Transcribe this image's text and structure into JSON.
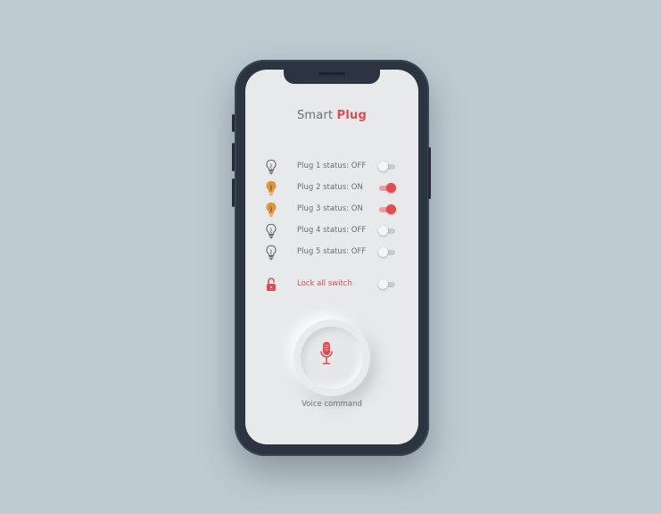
{
  "app": {
    "title_plain": "Smart",
    "title_accent": "Plug"
  },
  "plugs": [
    {
      "label": "Plug 1 status: OFF",
      "on": false
    },
    {
      "label": "Plug 2 status: ON",
      "on": true
    },
    {
      "label": "Plug 3 status: ON",
      "on": true
    },
    {
      "label": "Plug 4 status: OFF",
      "on": false
    },
    {
      "label": "Plug 5 status: OFF",
      "on": false
    }
  ],
  "lock": {
    "label": "Lock all switch",
    "on": false,
    "icon": "unlock-icon"
  },
  "voice": {
    "label": "Voice command",
    "icon": "microphone-icon"
  },
  "colors": {
    "accent": "#e14b52",
    "bulb_on": "#e0953a",
    "bulb_off": "#5a5e66",
    "screen_bg": "#e8e9eb",
    "body_bg": "#bfcbd2",
    "phone": "#2d3441"
  }
}
